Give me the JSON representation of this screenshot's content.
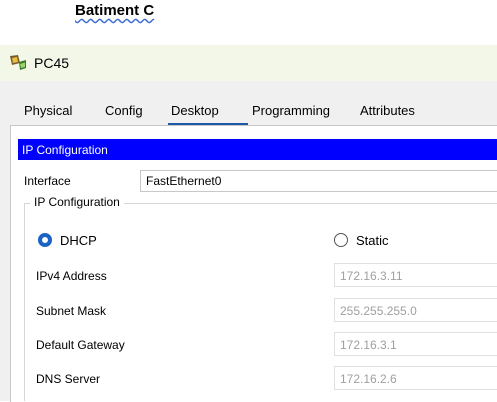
{
  "heading": "Batiment C",
  "window": {
    "title": "PC45"
  },
  "tabs": [
    {
      "label": "Physical"
    },
    {
      "label": "Config"
    },
    {
      "label": "Desktop"
    },
    {
      "label": "Programming"
    },
    {
      "label": "Attributes"
    }
  ],
  "active_tab": "Desktop",
  "ip_config": {
    "header": "IP Configuration",
    "interface_label": "Interface",
    "interface_value": "FastEthernet0",
    "group_label": "IP Configuration",
    "dhcp_label": "DHCP",
    "static_label": "Static",
    "mode": "DHCP",
    "fields": [
      {
        "label": "IPv4 Address",
        "value": "172.16.3.11"
      },
      {
        "label": "Subnet Mask",
        "value": "255.255.255.0"
      },
      {
        "label": "Default Gateway",
        "value": "172.16.3.1"
      },
      {
        "label": "DNS Server",
        "value": "172.16.2.6"
      }
    ]
  },
  "colors": {
    "header_bar": "#0000ff",
    "title_bar": "#f2f7e8",
    "active_tab_underline": "#1e5aa8",
    "radio_selected": "#1a63c6"
  }
}
